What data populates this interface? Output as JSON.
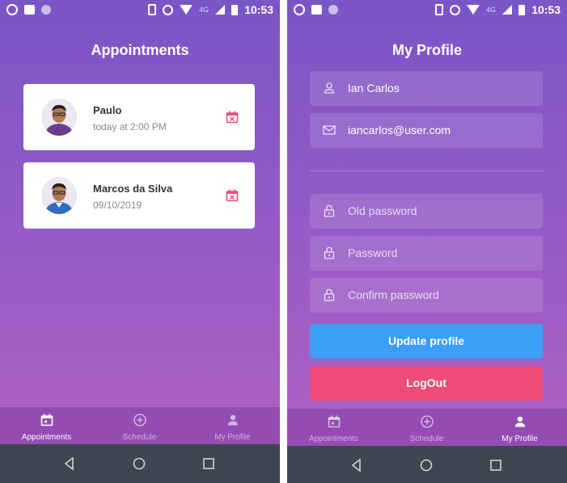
{
  "status_bar": {
    "time": "10:53",
    "network": "4G"
  },
  "appointments_screen": {
    "title": "Appointments",
    "appointments": [
      {
        "name": "Paulo",
        "date": "today at 2:00 PM"
      },
      {
        "name": "Marcos da Silva",
        "date": "09/10/2019"
      }
    ]
  },
  "profile_screen": {
    "title": "My Profile",
    "name_value": "Ian Carlos",
    "email_value": "iancarlos@user.com",
    "old_password_placeholder": "Old password",
    "password_placeholder": "Password",
    "confirm_password_placeholder": "Confirm password",
    "update_button": "Update profile",
    "logout_button": "LogOut"
  },
  "tabs": [
    {
      "label": "Appointments",
      "icon": "calendar-icon"
    },
    {
      "label": "Schedule",
      "icon": "add-circle-icon"
    },
    {
      "label": "My Profile",
      "icon": "person-icon"
    }
  ],
  "colors": {
    "gradient_top": "#7a55c6",
    "gradient_bottom": "#b262c4",
    "cancel_icon": "#f04c78",
    "update_button": "#3a9ff5",
    "logout_button": "#f04c78"
  }
}
